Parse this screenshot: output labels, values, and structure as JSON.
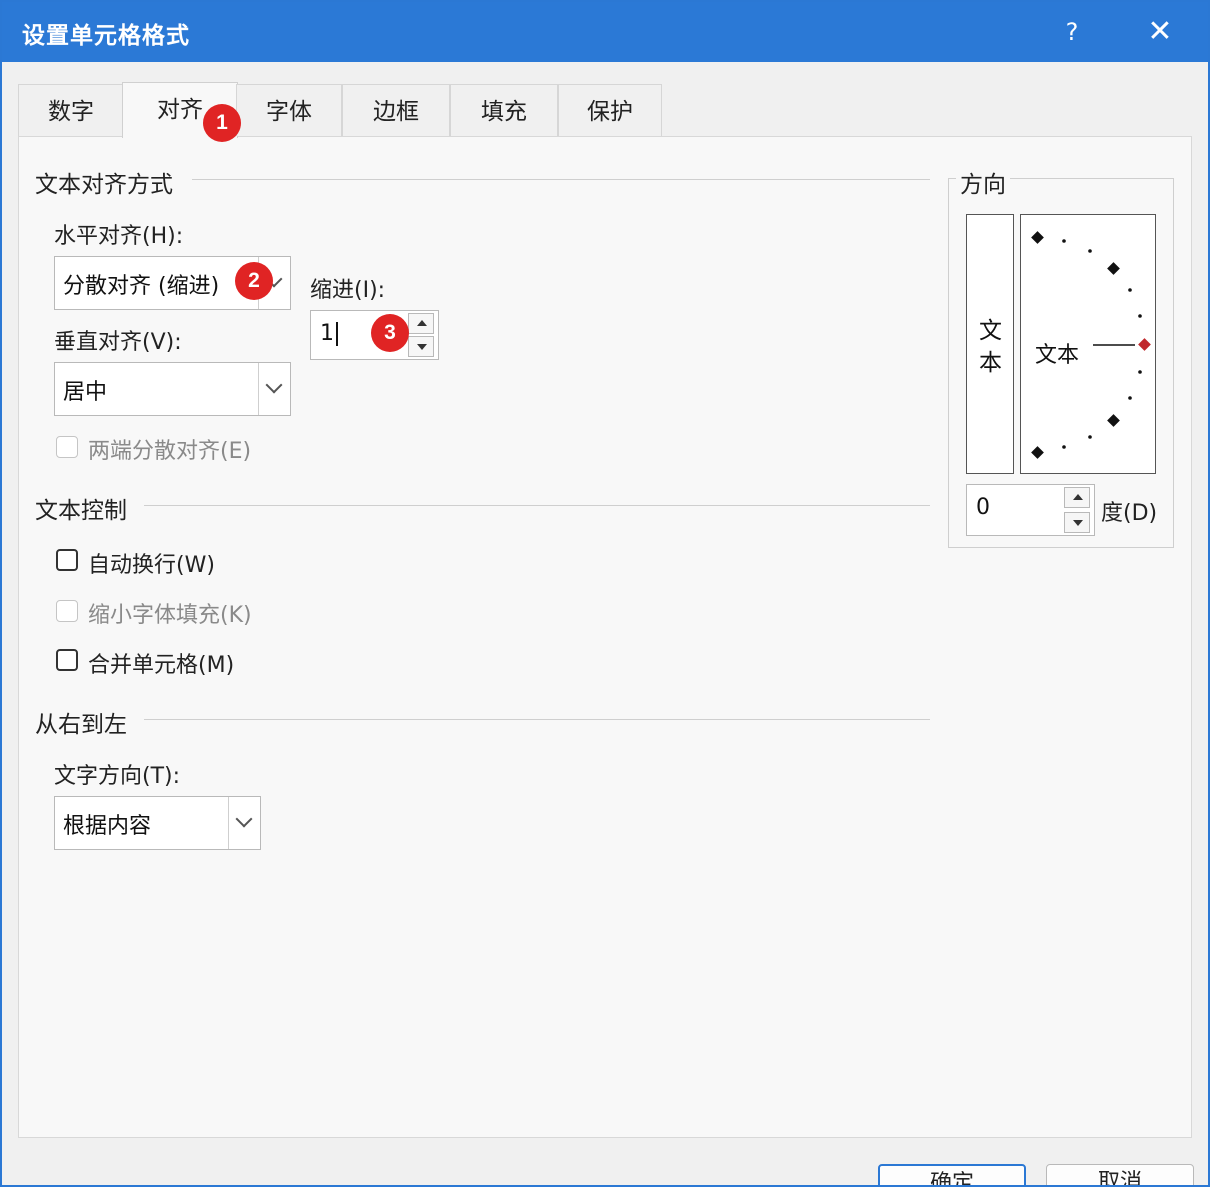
{
  "dialog": {
    "title": "设置单元格格式",
    "help": "?",
    "close": "✕"
  },
  "tabs": [
    "数字",
    "对齐",
    "字体",
    "边框",
    "填充",
    "保护"
  ],
  "text_alignment": {
    "section": "文本对齐方式",
    "horizontal_label": "水平对齐(H):",
    "horizontal_value": "分散对齐 (缩进)",
    "indent_label": "缩进(I):",
    "indent_value": "1",
    "vertical_label": "垂直对齐(V):",
    "vertical_value": "居中",
    "justify_distributed": "两端分散对齐(E)"
  },
  "text_control": {
    "section": "文本控制",
    "wrap_text": "自动换行(W)",
    "shrink_to_fit": "缩小字体填充(K)",
    "merge_cells": "合并单元格(M)"
  },
  "right_to_left": {
    "section": "从右到左",
    "direction_label": "文字方向(T):",
    "direction_value": "根据内容"
  },
  "orientation": {
    "section": "方向",
    "vertical_text": "文\n本",
    "dial_text": "文本",
    "degrees_value": "0",
    "degrees_label": "度(D)"
  },
  "annotations": [
    "1",
    "2",
    "3"
  ],
  "footer": {
    "ok": "确定",
    "cancel": "取消"
  },
  "colors": {
    "titlebar": "#2b79d6",
    "badge": "#e02424",
    "dial_pointer": "#c0282c"
  }
}
